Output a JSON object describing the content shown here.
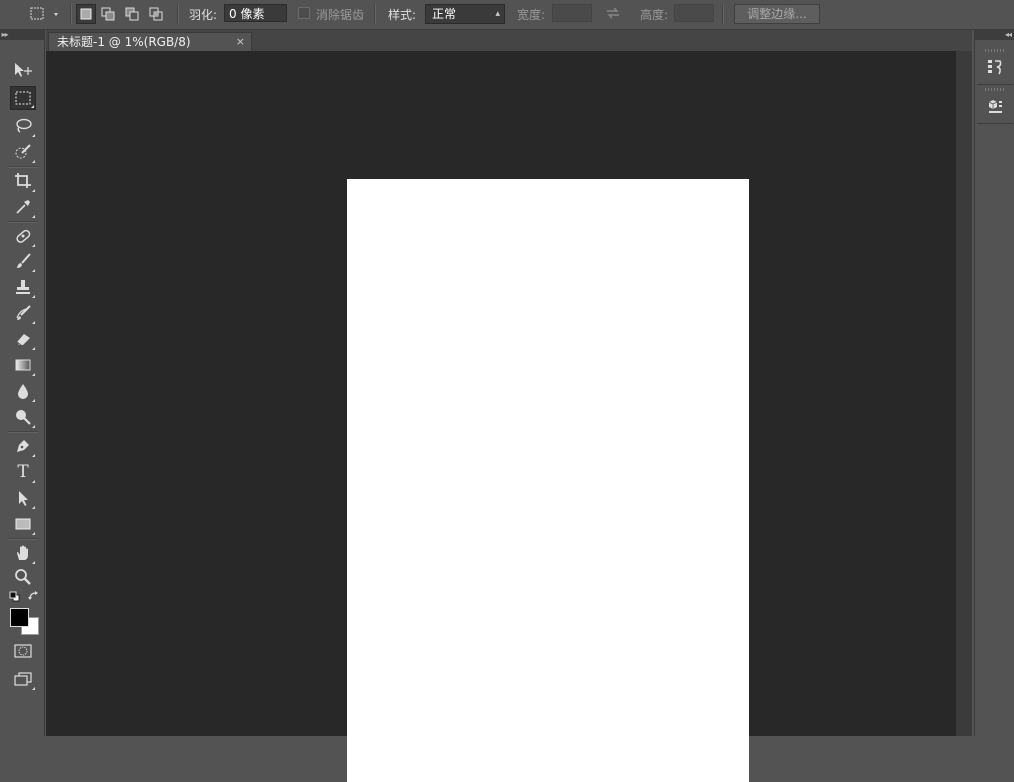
{
  "options_bar": {
    "feather_label": "羽化:",
    "feather_value": "0 像素",
    "anti_alias_label": "消除锯齿",
    "style_label": "样式:",
    "style_value": "正常",
    "width_label": "宽度:",
    "height_label": "高度:",
    "refine_edge_label": "调整边缘..."
  },
  "document": {
    "tab_title": "未标题-1 @ 1%(RGB/8)",
    "tab_close": "×",
    "page_color": "#ffffff"
  },
  "tools": [
    "move-tool-icon",
    "rectangular-marquee-tool-icon",
    "lasso-tool-icon",
    "quick-selection-tool-icon",
    "crop-tool-icon",
    "eyedropper-tool-icon",
    "spot-healing-brush-tool-icon",
    "brush-tool-icon",
    "clone-stamp-tool-icon",
    "history-brush-tool-icon",
    "eraser-tool-icon",
    "gradient-tool-icon",
    "blur-tool-icon",
    "dodge-tool-icon",
    "pen-tool-icon",
    "type-tool-icon",
    "path-selection-tool-icon",
    "rectangle-tool-icon",
    "hand-tool-icon",
    "zoom-tool-icon"
  ],
  "colors": {
    "foreground": "#000000",
    "background": "#ffffff",
    "ui_panel": "#535353",
    "canvas_bg": "#282828"
  },
  "type_tool_glyph": "T"
}
